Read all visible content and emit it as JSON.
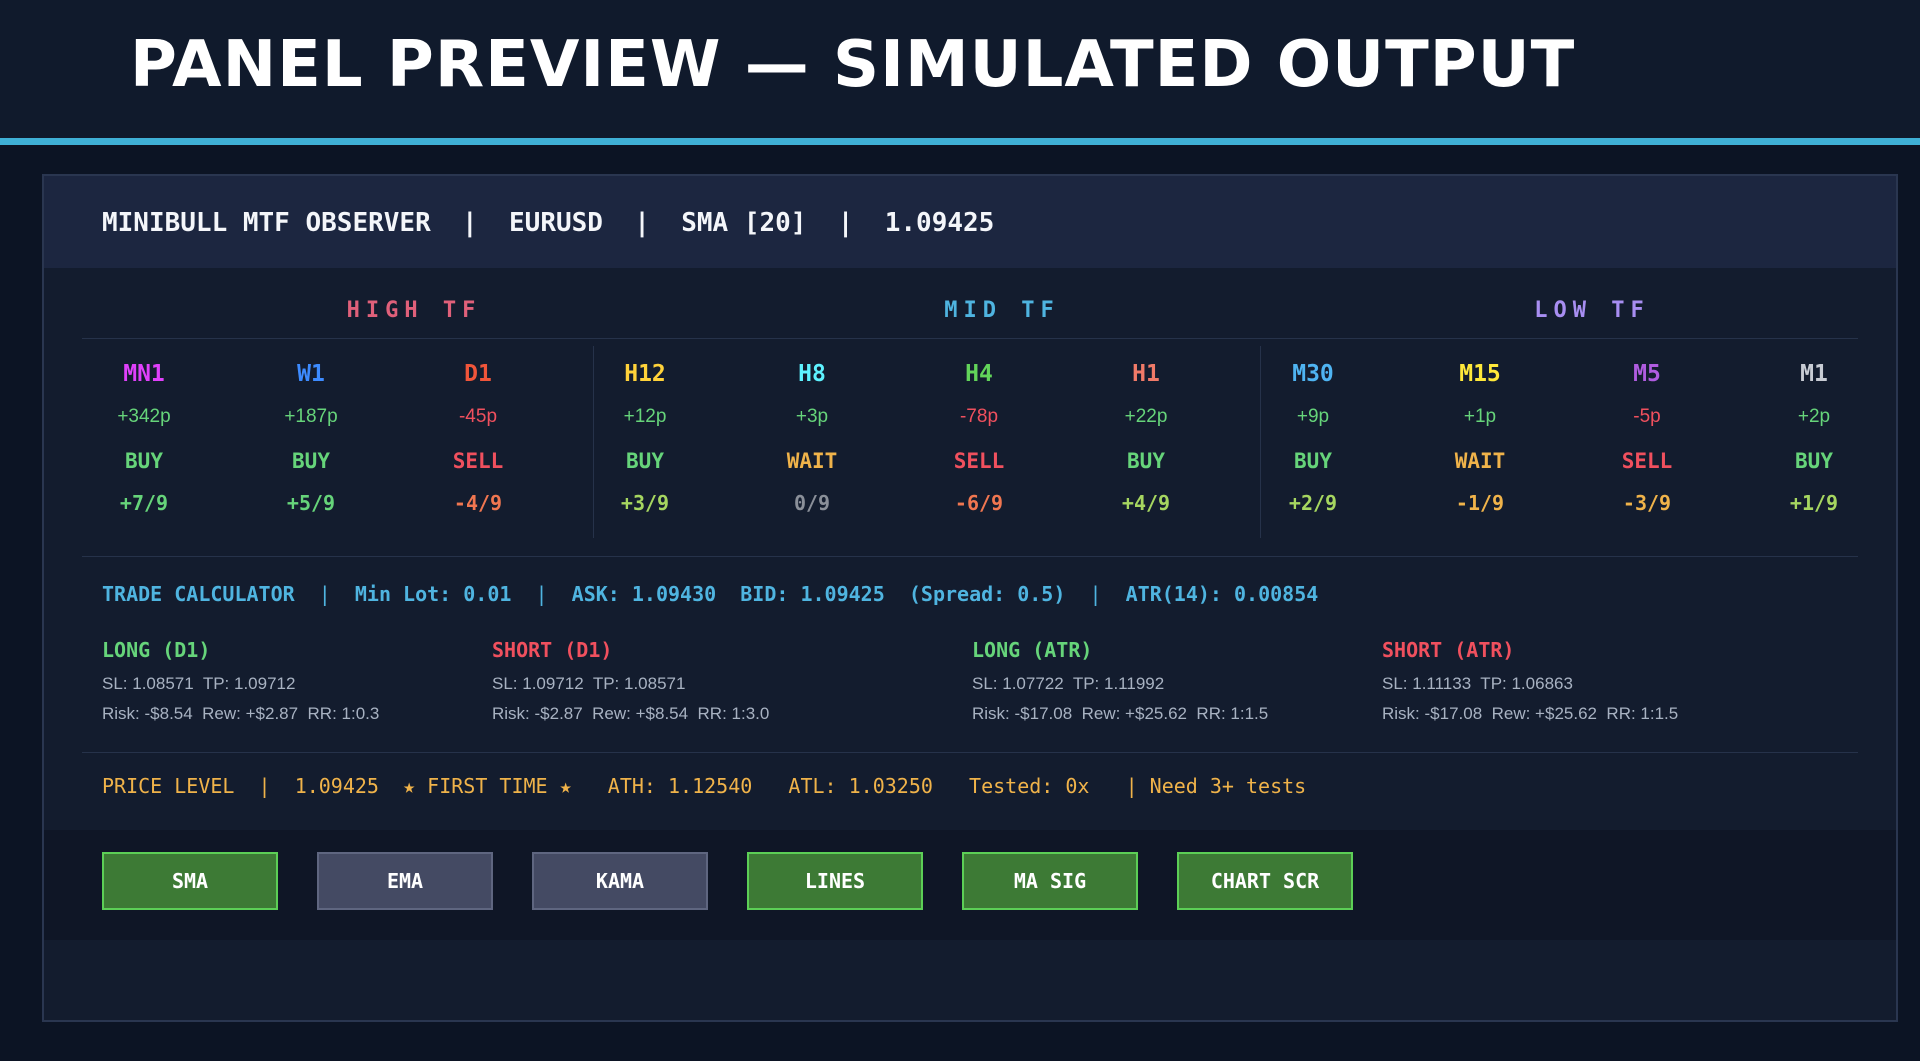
{
  "page_title": "PANEL PREVIEW — SIMULATED OUTPUT",
  "header": {
    "app": "MINIBULL MTF OBSERVER",
    "symbol": "EURUSD",
    "ma": "SMA [20]",
    "price": "1.09425",
    "sep": "|"
  },
  "groups": [
    {
      "label": "HIGH TF",
      "color": "#e0607a"
    },
    {
      "label": "MID TF",
      "color": "#4fb4e0"
    },
    {
      "label": "LOW TF",
      "color": "#a88ef2"
    }
  ],
  "timeframes": [
    {
      "name": "MN1",
      "name_color": "#e040fb",
      "pips": "+342p",
      "pips_color": "#66d47a",
      "signal": "BUY",
      "signal_color": "#66d47a",
      "score": "+7/9",
      "score_color": "#66d47a"
    },
    {
      "name": "W1",
      "name_color": "#3d8bff",
      "pips": "+187p",
      "pips_color": "#66d47a",
      "signal": "BUY",
      "signal_color": "#66d47a",
      "score": "+5/9",
      "score_color": "#66d47a"
    },
    {
      "name": "D1",
      "name_color": "#f0553a",
      "pips": "-45p",
      "pips_color": "#f0505e",
      "signal": "SELL",
      "signal_color": "#f0505e",
      "score": "-4/9",
      "score_color": "#f07650"
    },
    {
      "name": "H12",
      "name_color": "#ffd23a",
      "pips": "+12p",
      "pips_color": "#66d47a",
      "signal": "BUY",
      "signal_color": "#66d47a",
      "score": "+3/9",
      "score_color": "#a6d660"
    },
    {
      "name": "H8",
      "name_color": "#5ef2ff",
      "pips": "+3p",
      "pips_color": "#66d47a",
      "signal": "WAIT",
      "signal_color": "#f0b34a",
      "score": "0/9",
      "score_color": "#8a8f99"
    },
    {
      "name": "H4",
      "name_color": "#62d45a",
      "pips": "-78p",
      "pips_color": "#f0505e",
      "signal": "SELL",
      "signal_color": "#f0505e",
      "score": "-6/9",
      "score_color": "#f07650"
    },
    {
      "name": "H1",
      "name_color": "#f07a68",
      "pips": "+22p",
      "pips_color": "#66d47a",
      "signal": "BUY",
      "signal_color": "#66d47a",
      "score": "+4/9",
      "score_color": "#a6d660"
    },
    {
      "name": "M30",
      "name_color": "#4fb4f2",
      "pips": "+9p",
      "pips_color": "#66d47a",
      "signal": "BUY",
      "signal_color": "#66d47a",
      "score": "+2/9",
      "score_color": "#a6d660"
    },
    {
      "name": "M15",
      "name_color": "#ffe83a",
      "pips": "+1p",
      "pips_color": "#66d47a",
      "signal": "WAIT",
      "signal_color": "#f0b34a",
      "score": "-1/9",
      "score_color": "#f0b34a"
    },
    {
      "name": "M5",
      "name_color": "#b05ce0",
      "pips": "-5p",
      "pips_color": "#f0505e",
      "signal": "SELL",
      "signal_color": "#f0505e",
      "score": "-3/9",
      "score_color": "#f0b34a"
    },
    {
      "name": "M1",
      "name_color": "#c8ccd4",
      "pips": "+2p",
      "pips_color": "#66d47a",
      "signal": "BUY",
      "signal_color": "#66d47a",
      "score": "+1/9",
      "score_color": "#a6d660"
    }
  ],
  "calculator": {
    "label": "TRADE CALCULATOR",
    "min_lot": "Min Lot: 0.01",
    "ask": "ASK: 1.09430",
    "bid": "BID: 1.09425",
    "spread": "(Spread: 0.5)",
    "atr": "ATR(14): 0.00854",
    "sep": "|"
  },
  "trades": [
    {
      "title": "LONG (D1)",
      "color": "#66d47a",
      "levels": "SL: 1.08571  TP: 1.09712",
      "risk": "Risk: -$8.54  Rew: +$2.87  RR: 1:0.3"
    },
    {
      "title": "SHORT (D1)",
      "color": "#f0505e",
      "levels": "SL: 1.09712  TP: 1.08571",
      "risk": "Risk: -$2.87  Rew: +$8.54  RR: 1:3.0"
    },
    {
      "title": "LONG (ATR)",
      "color": "#66d47a",
      "levels": "SL: 1.07722  TP: 1.11992",
      "risk": "Risk: -$17.08  Rew: +$25.62  RR: 1:1.5"
    },
    {
      "title": "SHORT (ATR)",
      "color": "#f0505e",
      "levels": "SL: 1.11133  TP: 1.06863",
      "risk": "Risk: -$17.08  Rew: +$25.62  RR: 1:1.5"
    }
  ],
  "price_level": {
    "label": "PRICE LEVEL",
    "sep": "|",
    "value": "1.09425",
    "first_time": "★ FIRST TIME ★",
    "ath": "ATH: 1.12540",
    "atl": "ATL: 1.03250",
    "tested": "Tested: 0x",
    "need": "| Need 3+ tests"
  },
  "buttons": [
    {
      "label": "SMA",
      "active": true
    },
    {
      "label": "EMA",
      "active": false
    },
    {
      "label": "KAMA",
      "active": false
    },
    {
      "label": "LINES",
      "active": true
    },
    {
      "label": "MA SIG",
      "active": true
    },
    {
      "label": "CHART SCR",
      "active": true
    }
  ]
}
